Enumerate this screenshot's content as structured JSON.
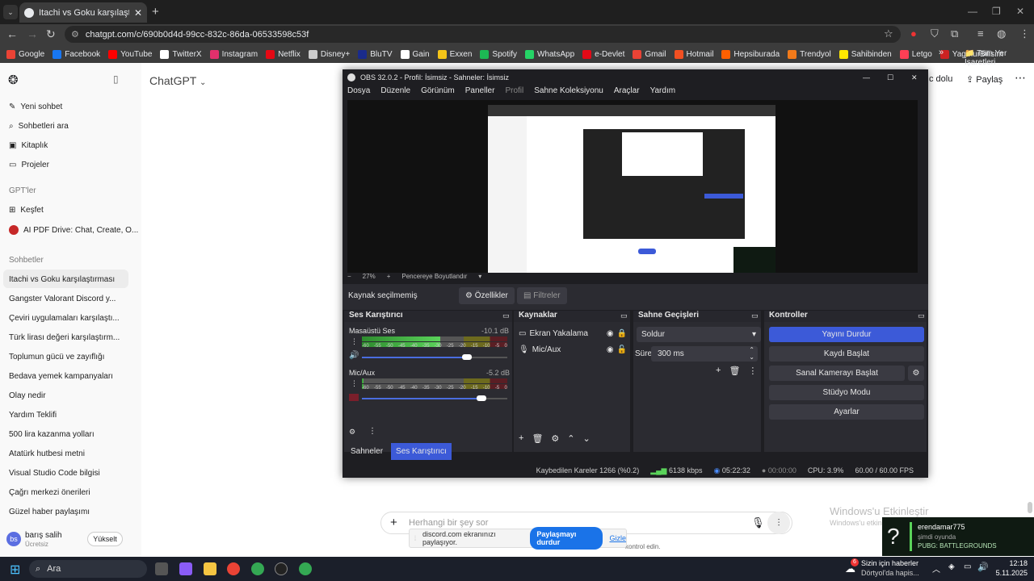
{
  "browser": {
    "tab_title": "Itachi vs Goku karşılaştırması",
    "url": "chatgpt.com/c/690b0d4d-99cc-832c-86da-06533598c53f",
    "bookmarks": [
      {
        "label": "Google",
        "color": "#ea4335"
      },
      {
        "label": "Facebook",
        "color": "#1877f2"
      },
      {
        "label": "YouTube",
        "color": "#ff0000"
      },
      {
        "label": "TwitterX",
        "color": "#ffffff"
      },
      {
        "label": "Instagram",
        "color": "#e1306c"
      },
      {
        "label": "Netflix",
        "color": "#e50914"
      },
      {
        "label": "Disney+",
        "color": "#cccccc"
      },
      {
        "label": "BluTV",
        "color": "#1a2b8c"
      },
      {
        "label": "Gain",
        "color": "#ffffff"
      },
      {
        "label": "Exxen",
        "color": "#f5c518"
      },
      {
        "label": "Spotify",
        "color": "#1db954"
      },
      {
        "label": "WhatsApp",
        "color": "#25d366"
      },
      {
        "label": "e-Devlet",
        "color": "#e30a17"
      },
      {
        "label": "Gmail",
        "color": "#ea4335"
      },
      {
        "label": "Hotmail",
        "color": "#f25022"
      },
      {
        "label": "Hepsiburada",
        "color": "#ff6000"
      },
      {
        "label": "Trendyol",
        "color": "#f27a1a"
      },
      {
        "label": "Sahibinden",
        "color": "#ffe800"
      },
      {
        "label": "Letgo",
        "color": "#ff3f55"
      },
      {
        "label": "YagmurBilisim",
        "color": "#cc2222"
      }
    ],
    "all_bookmarks": "Tüm Yer İşaretleri"
  },
  "chatgpt": {
    "menu": {
      "new_chat": "Yeni sohbet",
      "search": "Sohbetleri ara",
      "library": "Kitaplık",
      "projects": "Projeler",
      "gpts_header": "GPT'ler",
      "explore": "Keşfet",
      "pdf": "AI PDF Drive: Chat, Create, O...",
      "chats_header": "Sohbetler"
    },
    "chats": [
      "Itachi vs Goku karşılaştırması",
      "Gangster Valorant Discord y...",
      "Çeviri uygulamaları karşılaştı...",
      "Türk lirası değeri karşılaştırm...",
      "Toplumun gücü ve zayıflığı",
      "Bedava yemek kampanyaları",
      "Olay nedir",
      "Yardım Teklifi",
      "500 lira kazanma yolları",
      "Atatürk hutbesi metni",
      "Visual Studio Code bilgisi",
      "Çağrı merkezi önerileri",
      "Güzel haber paylaşımı"
    ],
    "user": {
      "initials": "bs",
      "name": "barış salih",
      "plan": "Ücretsiz",
      "upgrade": "Yükselt"
    },
    "title": "ChatGPT",
    "partial_text": "c dolu",
    "share": "Paylaş",
    "composer_placeholder": "Herhangi bir şey sor",
    "control_text": "kontrol edin."
  },
  "discord_share": {
    "text": "discord.com ekranınızı paylaşıyor.",
    "stop": "Paylaşmayı durdur",
    "hide": "Gizle"
  },
  "obs": {
    "title": "OBS 32.0.2 - Profil: İsimsiz - Sahneler: İsimsiz",
    "menu": [
      "Dosya",
      "Düzenle",
      "Görünüm",
      "Paneller",
      "Profil",
      "Sahne Koleksiyonu",
      "Araçlar",
      "Yardım"
    ],
    "zoom": "27%",
    "fit": "Pencereye Boyutlandır",
    "no_source": "Kaynak seçilmemiş",
    "properties": "Özellikler",
    "filters": "Filtreler",
    "mixer": {
      "title": "Ses Karıştırıcı",
      "ch1_name": "Masaüstü Ses",
      "ch1_db": "-10.1 dB",
      "ch1_level": 0.72,
      "ch2_name": "Mic/Aux",
      "ch2_db": "-5.2 dB",
      "ch2_level": 0.82,
      "ticks": [
        "-60",
        "-55",
        "-50",
        "-45",
        "-40",
        "-35",
        "-30",
        "-25",
        "-20",
        "-15",
        "-10",
        "-5",
        "0"
      ]
    },
    "sources": {
      "title": "Kaynaklar",
      "items": [
        "Ekran Yakalama",
        "Mic/Aux"
      ]
    },
    "transitions": {
      "title": "Sahne Geçişleri",
      "type": "Soldur",
      "duration_label": "Süre",
      "duration": "300 ms"
    },
    "controls": {
      "title": "Kontroller",
      "stop_stream": "Yayını Durdur",
      "start_record": "Kaydı Başlat",
      "virtual_cam": "Sanal Kamerayı Başlat",
      "studio": "Stüdyo Modu",
      "settings": "Ayarlar"
    },
    "tabs": {
      "scenes": "Sahneler",
      "mixer": "Ses Karıştırıcı"
    },
    "status": {
      "dropped": "Kaybedilen Kareler 1266 (%0.2)",
      "bitrate": "6138 kbps",
      "stream_time": "05:22:32",
      "rec_time": "00:00:00",
      "cpu": "CPU: 3.9%",
      "fps": "60.00 / 60.00 FPS"
    },
    "accent": "#3c5ad8"
  },
  "windows": {
    "activate_title": "Windows'u Etkinleştir",
    "activate_sub": "Windows'u etkinleştirmek için Ayarlar'a gidin.",
    "toast": {
      "user": "erendamar775",
      "status": "şimdi oyunda",
      "game": "PUBG: BATTLEGROUNDS"
    },
    "search": "Ara",
    "news_title": "Sizin için haberler",
    "news_sub": "Dörtyol'da hapis...",
    "news_badge": "6",
    "time": "12:18",
    "date": "5.11.2025"
  }
}
